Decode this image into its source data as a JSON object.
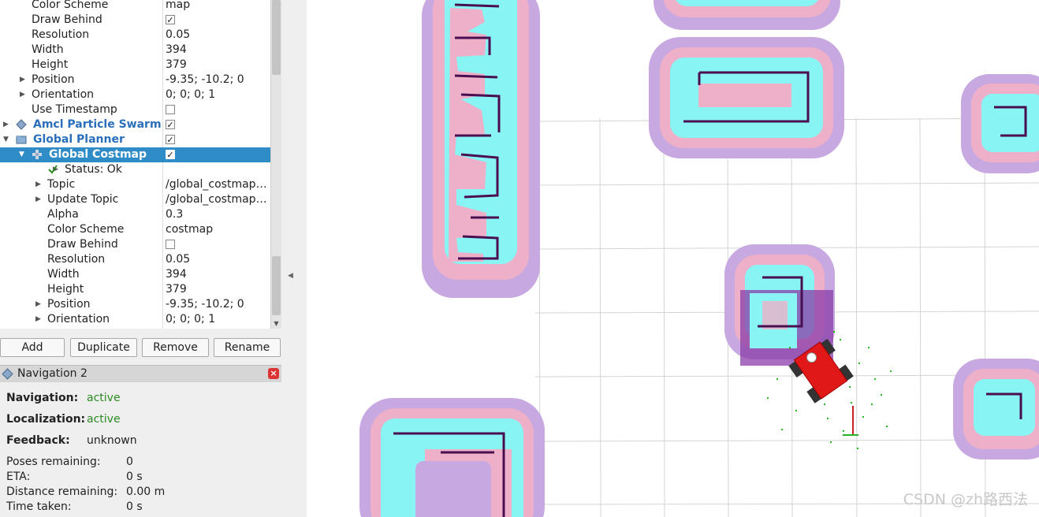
{
  "displays": {
    "rows": [
      {
        "name": "Color Scheme",
        "value": "map",
        "type": "text",
        "indent": 40
      },
      {
        "name": "Draw Behind",
        "checked": true,
        "type": "check",
        "indent": 40
      },
      {
        "name": "Resolution",
        "value": "0.05",
        "type": "text",
        "indent": 40
      },
      {
        "name": "Width",
        "value": "394",
        "type": "text",
        "indent": 40
      },
      {
        "name": "Height",
        "value": "379",
        "type": "text",
        "indent": 40
      },
      {
        "name": "Position",
        "value": "-9.35; -10.2; 0",
        "type": "text",
        "indent": 40,
        "arrow": true
      },
      {
        "name": "Orientation",
        "value": "0; 0; 0; 1",
        "type": "text",
        "indent": 40,
        "arrow": true
      },
      {
        "name": "Use Timestamp",
        "checked": false,
        "type": "check",
        "indent": 40
      },
      {
        "name": "Amcl Particle Swarm",
        "checked": true,
        "type": "check",
        "indent": 42,
        "arrow": true,
        "display": true,
        "icon": "diamond-icon"
      },
      {
        "name": "Global Planner",
        "checked": true,
        "type": "check",
        "indent": 42,
        "arrow": "open",
        "display": true,
        "icon": "folder-icon"
      },
      {
        "name": "Global Costmap",
        "checked": true,
        "type": "check",
        "indent": 62,
        "arrow": "open",
        "display": true,
        "icon": "grid-icon",
        "selected": true
      },
      {
        "name": "Status: Ok",
        "type": "none",
        "indent": 82,
        "arrow": true,
        "icon": "checkmark-icon"
      },
      {
        "name": "Topic",
        "value": "/global_costmap/c...",
        "type": "text",
        "indent": 60,
        "arrow": true
      },
      {
        "name": "Update Topic",
        "value": "/global_costmap/c...",
        "type": "text",
        "indent": 60,
        "arrow": true
      },
      {
        "name": "Alpha",
        "value": "0.3",
        "type": "text",
        "indent": 60
      },
      {
        "name": "Color Scheme",
        "value": "costmap",
        "type": "text",
        "indent": 60
      },
      {
        "name": "Draw Behind",
        "checked": false,
        "type": "check",
        "indent": 60
      },
      {
        "name": "Resolution",
        "value": "0.05",
        "type": "text",
        "indent": 60
      },
      {
        "name": "Width",
        "value": "394",
        "type": "text",
        "indent": 60
      },
      {
        "name": "Height",
        "value": "379",
        "type": "text",
        "indent": 60
      },
      {
        "name": "Position",
        "value": "-9.35; -10.2; 0",
        "type": "text",
        "indent": 60,
        "arrow": true
      },
      {
        "name": "Orientation",
        "value": "0; 0; 0; 1",
        "type": "text",
        "indent": 60,
        "arrow": true
      }
    ],
    "buttons": {
      "add": "Add",
      "duplicate": "Duplicate",
      "remove": "Remove",
      "rename": "Rename"
    }
  },
  "navigation_panel": {
    "title": "Navigation 2",
    "navigation_label": "Navigation:",
    "navigation_value": "active",
    "localization_label": "Localization:",
    "localization_value": "active",
    "feedback_label": "Feedback:",
    "feedback_value": "unknown",
    "poses_label": "Poses remaining:",
    "poses_value": "0",
    "eta_label": "ETA:",
    "eta_value": "0 s",
    "distance_label": "Distance remaining:",
    "distance_value": "0.00 m",
    "time_label": "Time taken:",
    "time_value": "0 s"
  },
  "colors": {
    "selection": "#308cc6",
    "display_name": "#2a6fbb",
    "active": "#2c8a22",
    "costmap_outer": "#c8a8e0",
    "costmap_mid": "#eeb0c8",
    "costmap_inner": "#88f4f4",
    "obstacle": "#4a0e50",
    "robot": "#e01818"
  },
  "watermark": "CSDN @zh路西法"
}
